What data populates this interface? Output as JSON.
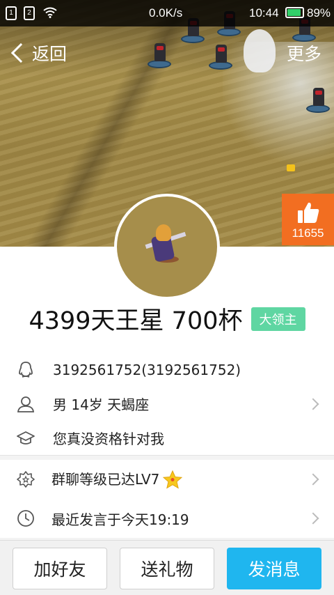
{
  "status_bar": {
    "sim1": "1",
    "sim2": "2",
    "speed": "0.0K/s",
    "time": "10:44",
    "battery_pct": "89%",
    "battery_level": 0.89,
    "icons": [
      "sim-card-icon",
      "sim-card-icon",
      "wifi-icon",
      "battery-icon"
    ]
  },
  "nav": {
    "back_label": "返回",
    "more_label": "更多"
  },
  "like": {
    "count": "11655",
    "icon": "thumbs-up-icon",
    "color": "#f26e21"
  },
  "profile": {
    "name": "4399天王星 700杯",
    "badge": "大领主",
    "badge_color": "#5fd6a2"
  },
  "info_rows": [
    {
      "icon": "penguin-icon",
      "text": "3192561752(3192561752)",
      "has_arrow": false
    },
    {
      "icon": "person-icon",
      "text": "男  14岁  天蝎座",
      "has_arrow": true
    },
    {
      "icon": "graduation-cap-icon",
      "text": "您真没资格针对我",
      "has_arrow": false
    }
  ],
  "group_rows": [
    {
      "icon": "badge-gear-icon",
      "text": "群聊等级已达LV7",
      "extra_icon": "star-icon",
      "has_arrow": true
    },
    {
      "icon": "clock-icon",
      "text": "最近发言于今天19:19",
      "has_arrow": true
    }
  ],
  "actions": {
    "add_friend": "加好友",
    "send_gift": "送礼物",
    "send_message": "发消息",
    "primary_color": "#1fb6ef"
  }
}
